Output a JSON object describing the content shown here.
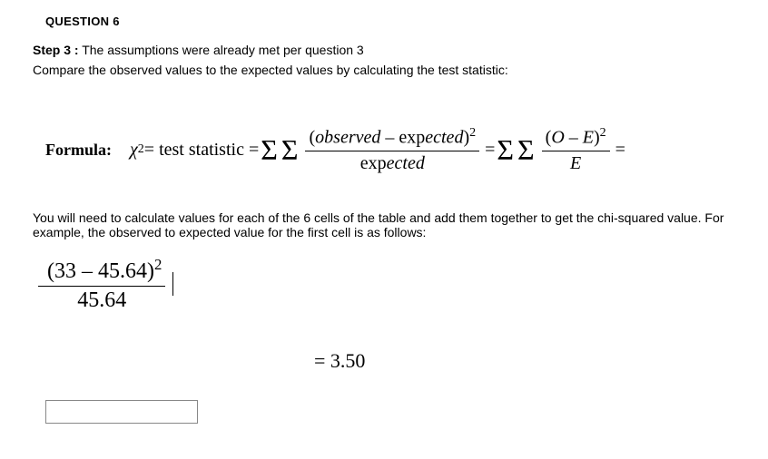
{
  "heading": "QUESTION 6",
  "step": {
    "label": "Step 3 :",
    "text": " The assumptions were already met per question 3"
  },
  "compare_text": "Compare the observed values to the expected values by calculating the test statistic:",
  "formula": {
    "label": "Formula:",
    "chi": "χ",
    "chisq_exp": "2",
    "eq1": " = test statistic = ",
    "sigma": "Σ",
    "frac1_num_left": "(",
    "frac1_num_obs": "observed",
    "frac1_num_minus": " – ",
    "frac1_num_exp_pre": "exp",
    "frac1_num_exp_post": "ected",
    "frac1_num_right": ")",
    "frac1_num_pow": "2",
    "frac1_den_pre": "exp",
    "frac1_den_post": "ected",
    "eq2": " = ",
    "frac2_num": "(O – E)²",
    "frac2_num_o": "O",
    "frac2_num_e": "E",
    "frac2_den": "E",
    "eq3": " ="
  },
  "explain": "You will need to calculate values for each of the 6 cells of the table and add them together to get the chi-squared value. For example, the observed to expected value for the first cell is as follows:",
  "example": {
    "num_left": "(",
    "num_val": "33 – 45.64",
    "num_right": ")",
    "num_pow": "2",
    "den": "45.64"
  },
  "answer": {
    "eq": "= ",
    "value": "3.50"
  },
  "input": {
    "value": ""
  }
}
